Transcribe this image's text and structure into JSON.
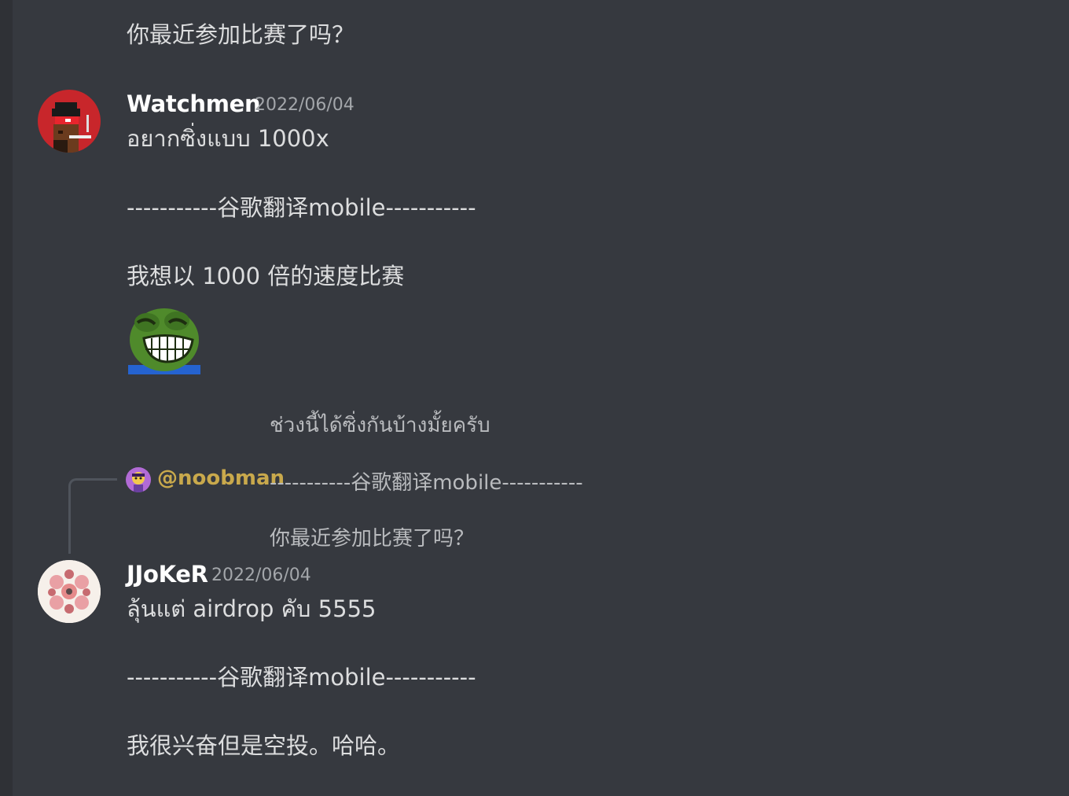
{
  "messages": {
    "top_continuation": {
      "text": "你最近参加比赛了吗？"
    },
    "watchmen": {
      "username": "Watchmen",
      "timestamp": "2022/06/04",
      "lines": [
        "อยากซิ่งแบบ 1000x",
        "-----------谷歌翻译mobile-----------",
        "我想以 1000 倍的速度比赛"
      ],
      "emoji": "pepe-laugh-emoji",
      "quoted_line": "ช่วงนี้ได้ซิ่งกันบ้างมั้ยครับ"
    },
    "reply": {
      "mention": "@noobman",
      "preview": "-----------谷歌翻译mobile-----------",
      "quoted_line": "你最近参加比赛了吗？"
    },
    "jjoker": {
      "username": "JJoKeR",
      "timestamp": "2022/06/04",
      "lines": [
        "ลุ้นแต่ airdrop คับ 5555",
        "-----------谷歌翻译mobile-----------",
        "我很兴奋但是空投。哈哈。"
      ]
    }
  },
  "colors": {
    "background": "#36393f",
    "mention": "#c9a94c",
    "timestamp": "#a3a6aa"
  }
}
